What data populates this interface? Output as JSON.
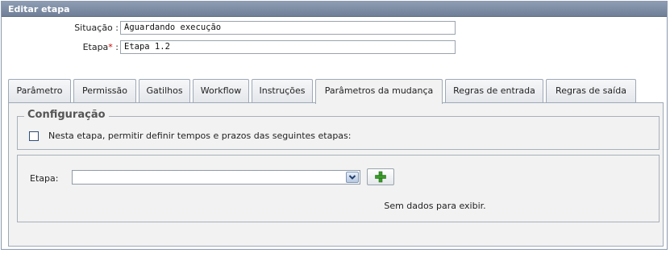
{
  "window": {
    "title": "Editar etapa"
  },
  "form": {
    "situacao": {
      "label": "Situação :",
      "value": "Aguardando execução"
    },
    "etapa": {
      "label": "Etapa",
      "required_mark": "*",
      "suffix": " :",
      "value": "Etapa 1.2"
    }
  },
  "tabs": [
    {
      "label": "Parâmetro",
      "active": false
    },
    {
      "label": "Permissão",
      "active": false
    },
    {
      "label": "Gatilhos",
      "active": false
    },
    {
      "label": "Workflow",
      "active": false
    },
    {
      "label": "Instruções",
      "active": false
    },
    {
      "label": "Parâmetros da mudança",
      "active": true
    },
    {
      "label": "Regras de entrada",
      "active": false
    },
    {
      "label": "Regras de saída",
      "active": false
    }
  ],
  "config": {
    "legend": "Configuração",
    "checkbox_label": "Nesta etapa, permitir definir tempos e prazos das seguintes etapas:",
    "checked": false
  },
  "grid": {
    "etapa_label": "Etapa:",
    "select_value": "",
    "empty_message": "Sem dados para exibir."
  },
  "colors": {
    "header": "#7d8ca3",
    "required": "#cc0000",
    "add_icon": "#3a9a2a"
  },
  "icons": {
    "dropdown": "chevron-down-icon",
    "add": "plus-icon"
  }
}
